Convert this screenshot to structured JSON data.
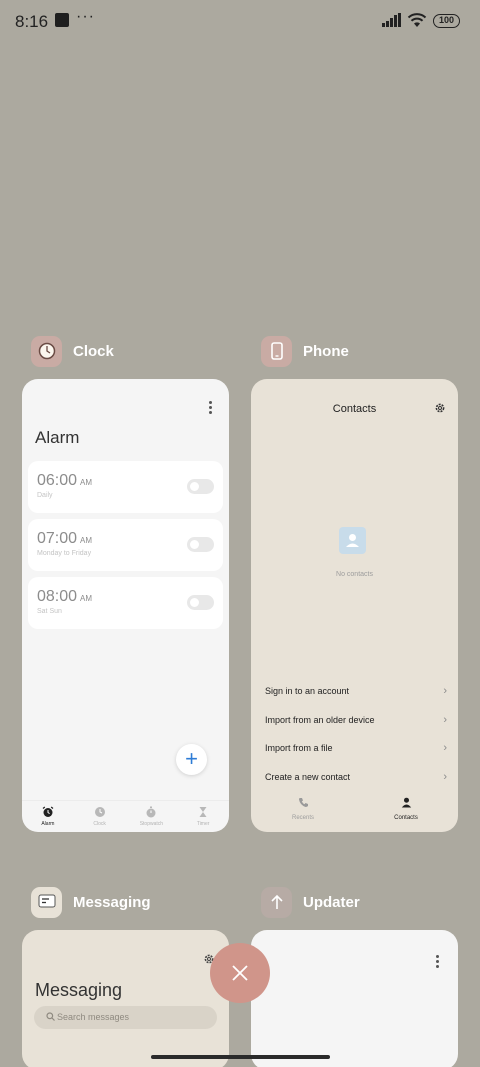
{
  "status_bar": {
    "time": "8:16",
    "dots": "···",
    "battery": "100"
  },
  "apps": {
    "clock": {
      "label": "Clock",
      "title": "Alarm",
      "alarms": [
        {
          "time": "06:00",
          "ampm": "AM",
          "repeat": "Daily",
          "enabled": false
        },
        {
          "time": "07:00",
          "ampm": "AM",
          "repeat": "Monday to Friday",
          "enabled": false
        },
        {
          "time": "08:00",
          "ampm": "AM",
          "repeat": "Sat Sun",
          "enabled": false
        }
      ],
      "fab_label": "+",
      "tabs": [
        {
          "label": "Alarm",
          "icon": "alarm-icon",
          "active": true
        },
        {
          "label": "Clock",
          "icon": "clock-icon",
          "active": false
        },
        {
          "label": "Stopwatch",
          "icon": "stopwatch-icon",
          "active": false
        },
        {
          "label": "Timer",
          "icon": "hourglass-icon",
          "active": false
        }
      ]
    },
    "phone": {
      "label": "Phone",
      "title": "Contacts",
      "empty_text": "No contacts",
      "options": [
        "Sign in to an account",
        "Import from an older device",
        "Import from a file",
        "Create a new contact"
      ],
      "tabs": [
        {
          "label": "Recents",
          "icon": "phone-icon",
          "active": false
        },
        {
          "label": "Contacts",
          "icon": "person-icon",
          "active": true
        }
      ]
    },
    "messaging": {
      "label": "Messaging",
      "title": "Messaging",
      "search_placeholder": "Search messages"
    },
    "updater": {
      "label": "Updater"
    }
  },
  "colors": {
    "background": "#aca99f",
    "accent_blue": "#2e7cd6",
    "close_button": "#d0958a"
  }
}
